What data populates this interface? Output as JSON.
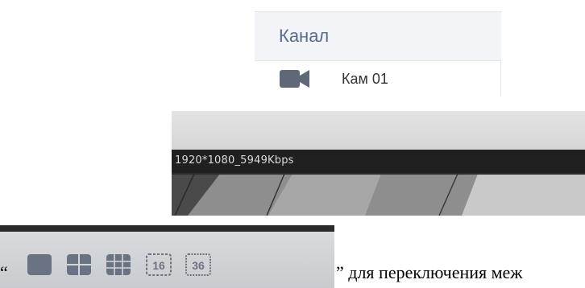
{
  "channel_panel": {
    "header": "Канал",
    "items": [
      {
        "label": "Кам 01",
        "icon": "video-camera-icon"
      }
    ]
  },
  "video_preview": {
    "overlay_text": "1920*1080_5949Kbps"
  },
  "layout_toolbar": {
    "buttons": [
      {
        "name": "layout-1-button",
        "icon": "single-view-icon",
        "label": ""
      },
      {
        "name": "layout-4-button",
        "icon": "quad-view-icon",
        "label": ""
      },
      {
        "name": "layout-9-button",
        "icon": "nine-view-icon",
        "label": ""
      },
      {
        "name": "layout-16-button",
        "icon": "sixteen-view-icon",
        "label": "16"
      },
      {
        "name": "layout-36-button",
        "icon": "thirtysix-view-icon",
        "label": "36"
      }
    ]
  },
  "caption": {
    "open_quote": "“",
    "text": "” для переключения меж"
  },
  "colors": {
    "header_text": "#5b6b8e",
    "icon_fill": "#6a7382",
    "toolbar_bg": "#cfd2d6"
  }
}
